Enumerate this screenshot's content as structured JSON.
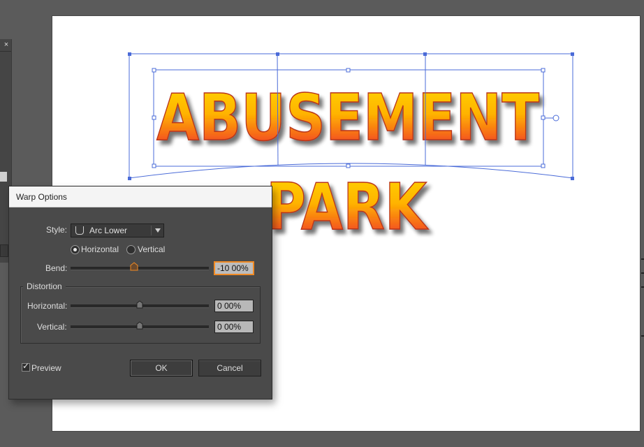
{
  "artwork": {
    "line1": "ABUSEMENT",
    "line2": "PARK",
    "colors": {
      "selection": "#4a6bd8",
      "text_top": "#ffd700",
      "text_bottom": "#e8361b"
    }
  },
  "dialog": {
    "title": "Warp Options",
    "style_label": "Style:",
    "style_value": "Arc Lower",
    "orientation": {
      "horizontal": "Horizontal",
      "vertical": "Vertical",
      "selected": "horizontal"
    },
    "bend": {
      "label": "Bend:",
      "value": "-10 00%",
      "level": 0.45
    },
    "distortion": {
      "title": "Distortion",
      "horizontal": {
        "label": "Horizontal:",
        "value": "0 00%",
        "level": 0.5
      },
      "vertical": {
        "label": "Vertical:",
        "value": "0 00%",
        "level": 0.5
      }
    },
    "preview_label": "Preview",
    "preview_checked": true,
    "ok_label": "OK",
    "cancel_label": "Cancel"
  },
  "left_panel": {
    "close_icon": "×"
  }
}
